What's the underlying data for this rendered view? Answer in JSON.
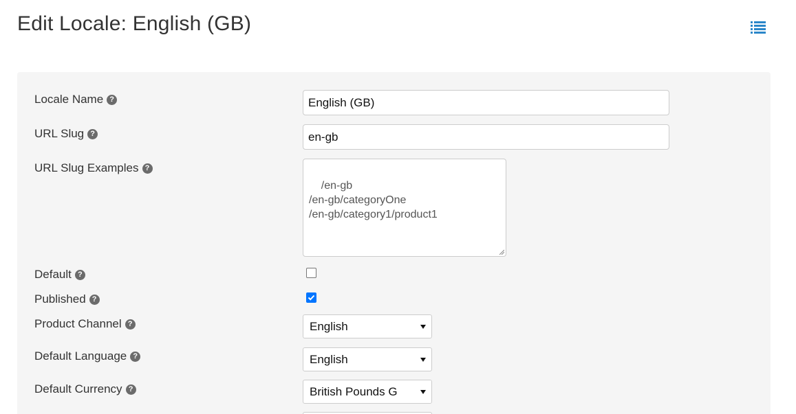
{
  "header": {
    "title": "Edit Locale: English (GB)",
    "list_icon": "list-icon"
  },
  "form": {
    "locale_name": {
      "label": "Locale Name",
      "value": "English (GB)",
      "help_icon": "question-circle-icon"
    },
    "url_slug": {
      "label": "URL Slug",
      "value": "en-gb",
      "help_icon": "question-circle-icon"
    },
    "url_slug_examples": {
      "label": "URL Slug Examples",
      "value": "/en-gb\n/en-gb/categoryOne\n/en-gb/category1/product1",
      "help_icon": "question-circle-icon"
    },
    "default": {
      "label": "Default",
      "checked": false,
      "help_icon": "question-circle-icon"
    },
    "published": {
      "label": "Published",
      "checked": true,
      "help_icon": "question-circle-icon"
    },
    "product_channel": {
      "label": "Product Channel",
      "selected": "English",
      "help_icon": "question-circle-icon"
    },
    "default_language": {
      "label": "Default Language",
      "selected": "English",
      "help_icon": "question-circle-icon"
    },
    "default_currency": {
      "label": "Default Currency",
      "selected": "British Pounds G",
      "help_icon": "question-circle-icon"
    },
    "help_glyph": "?"
  },
  "colors": {
    "panel_bg": "#f5f5f5",
    "accent": "#2a86c9",
    "checkbox_checked": "#0075ff"
  }
}
